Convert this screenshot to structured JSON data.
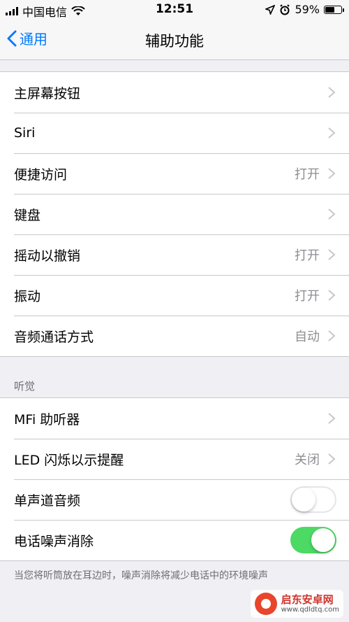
{
  "status_bar": {
    "carrier": "中国电信",
    "time": "12:51",
    "battery_percent": "59%",
    "battery_level": 0.59,
    "icons": [
      "signal-icon",
      "wifi-icon",
      "location-icon",
      "alarm-icon",
      "battery-icon"
    ]
  },
  "nav": {
    "back_label": "通用",
    "title": "辅助功能"
  },
  "group1": {
    "rows": [
      {
        "label": "主屏幕按钮",
        "value": ""
      },
      {
        "label": "Siri",
        "value": ""
      },
      {
        "label": "便捷访问",
        "value": "打开"
      },
      {
        "label": "键盘",
        "value": ""
      },
      {
        "label": "摇动以撤销",
        "value": "打开"
      },
      {
        "label": "振动",
        "value": "打开"
      },
      {
        "label": "音频通话方式",
        "value": "自动"
      }
    ]
  },
  "hearing": {
    "header": "听觉",
    "rows": [
      {
        "label": "MFi 助听器",
        "value": ""
      },
      {
        "label": "LED 闪烁以示提醒",
        "value": "关闭"
      },
      {
        "label": "单声道音频",
        "toggle": "off"
      },
      {
        "label": "电话噪声消除",
        "toggle": "on"
      }
    ],
    "footer": "当您将听筒放在耳边时，噪声消除将减少电话中的环境噪声"
  },
  "watermark": {
    "title": "启东安卓网",
    "url": "www.qdldtq.com"
  },
  "colors": {
    "accent": "#007aff",
    "toggle_on": "#4cd964",
    "background": "#efeff4"
  }
}
